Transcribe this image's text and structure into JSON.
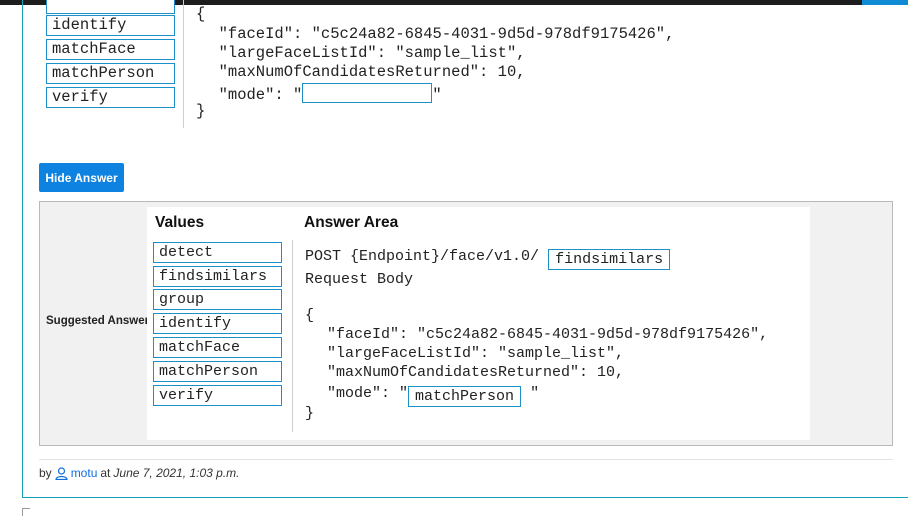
{
  "question": {
    "values": [
      "identify",
      "matchFace",
      "matchPerson",
      "verify"
    ],
    "code_lines": [
      "{",
      "  \"faceId\": \"c5c24a82-6845-4031-9d5d-978df9175426\",",
      "  \"largeFaceListId\": \"sample_list\",",
      "  \"maxNumOfCandidatesReturned\": 10,",
      "  \"mode\": \"",
      "}"
    ],
    "mode_suffix": "\""
  },
  "hide_answer_label": "Hide Answer",
  "suggested_answer_label": "Suggested Answer:",
  "answer": {
    "values_heading": "Values",
    "area_heading": "Answer Area",
    "values": [
      "detect",
      "findsimilars",
      "group",
      "identify",
      "matchFace",
      "matchPerson",
      "verify"
    ],
    "post_prefix": "POST {Endpoint}/face/v1.0/",
    "endpoint_selected": "findsimilars",
    "request_body_label": "Request Body",
    "code_lines": [
      "{",
      "  \"faceId\": \"c5c24a82-6845-4031-9d5d-978df9175426\",",
      "  \"largeFaceListId\": \"sample_list\",",
      "  \"maxNumOfCandidatesReturned\": 10,",
      "  \"mode\": \"",
      "}"
    ],
    "mode_selected": "matchPerson",
    "mode_suffix": "\""
  },
  "byline": {
    "by": "by",
    "user": "motu",
    "at": "at",
    "date": "June 7, 2021, 1:03 p.m."
  },
  "colors": {
    "accent": "#0d82e0",
    "box_border": "#1e90c8",
    "card_border": "#17a2b8"
  }
}
